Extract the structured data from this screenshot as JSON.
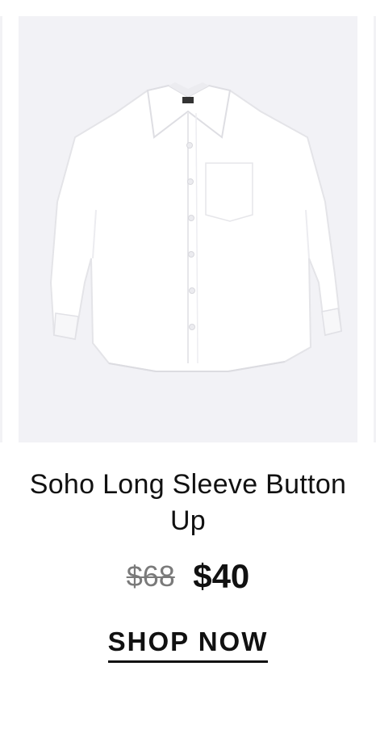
{
  "product": {
    "image_alt": "white long sleeve button up shirt",
    "title": "Soho Long Sleeve Button Up",
    "price_original": "$68",
    "price_sale": "$40",
    "cta_label": "SHOP NOW"
  },
  "colors": {
    "image_bg": "#f2f2f6",
    "text": "#111111",
    "muted_price": "#7a7a7a"
  }
}
